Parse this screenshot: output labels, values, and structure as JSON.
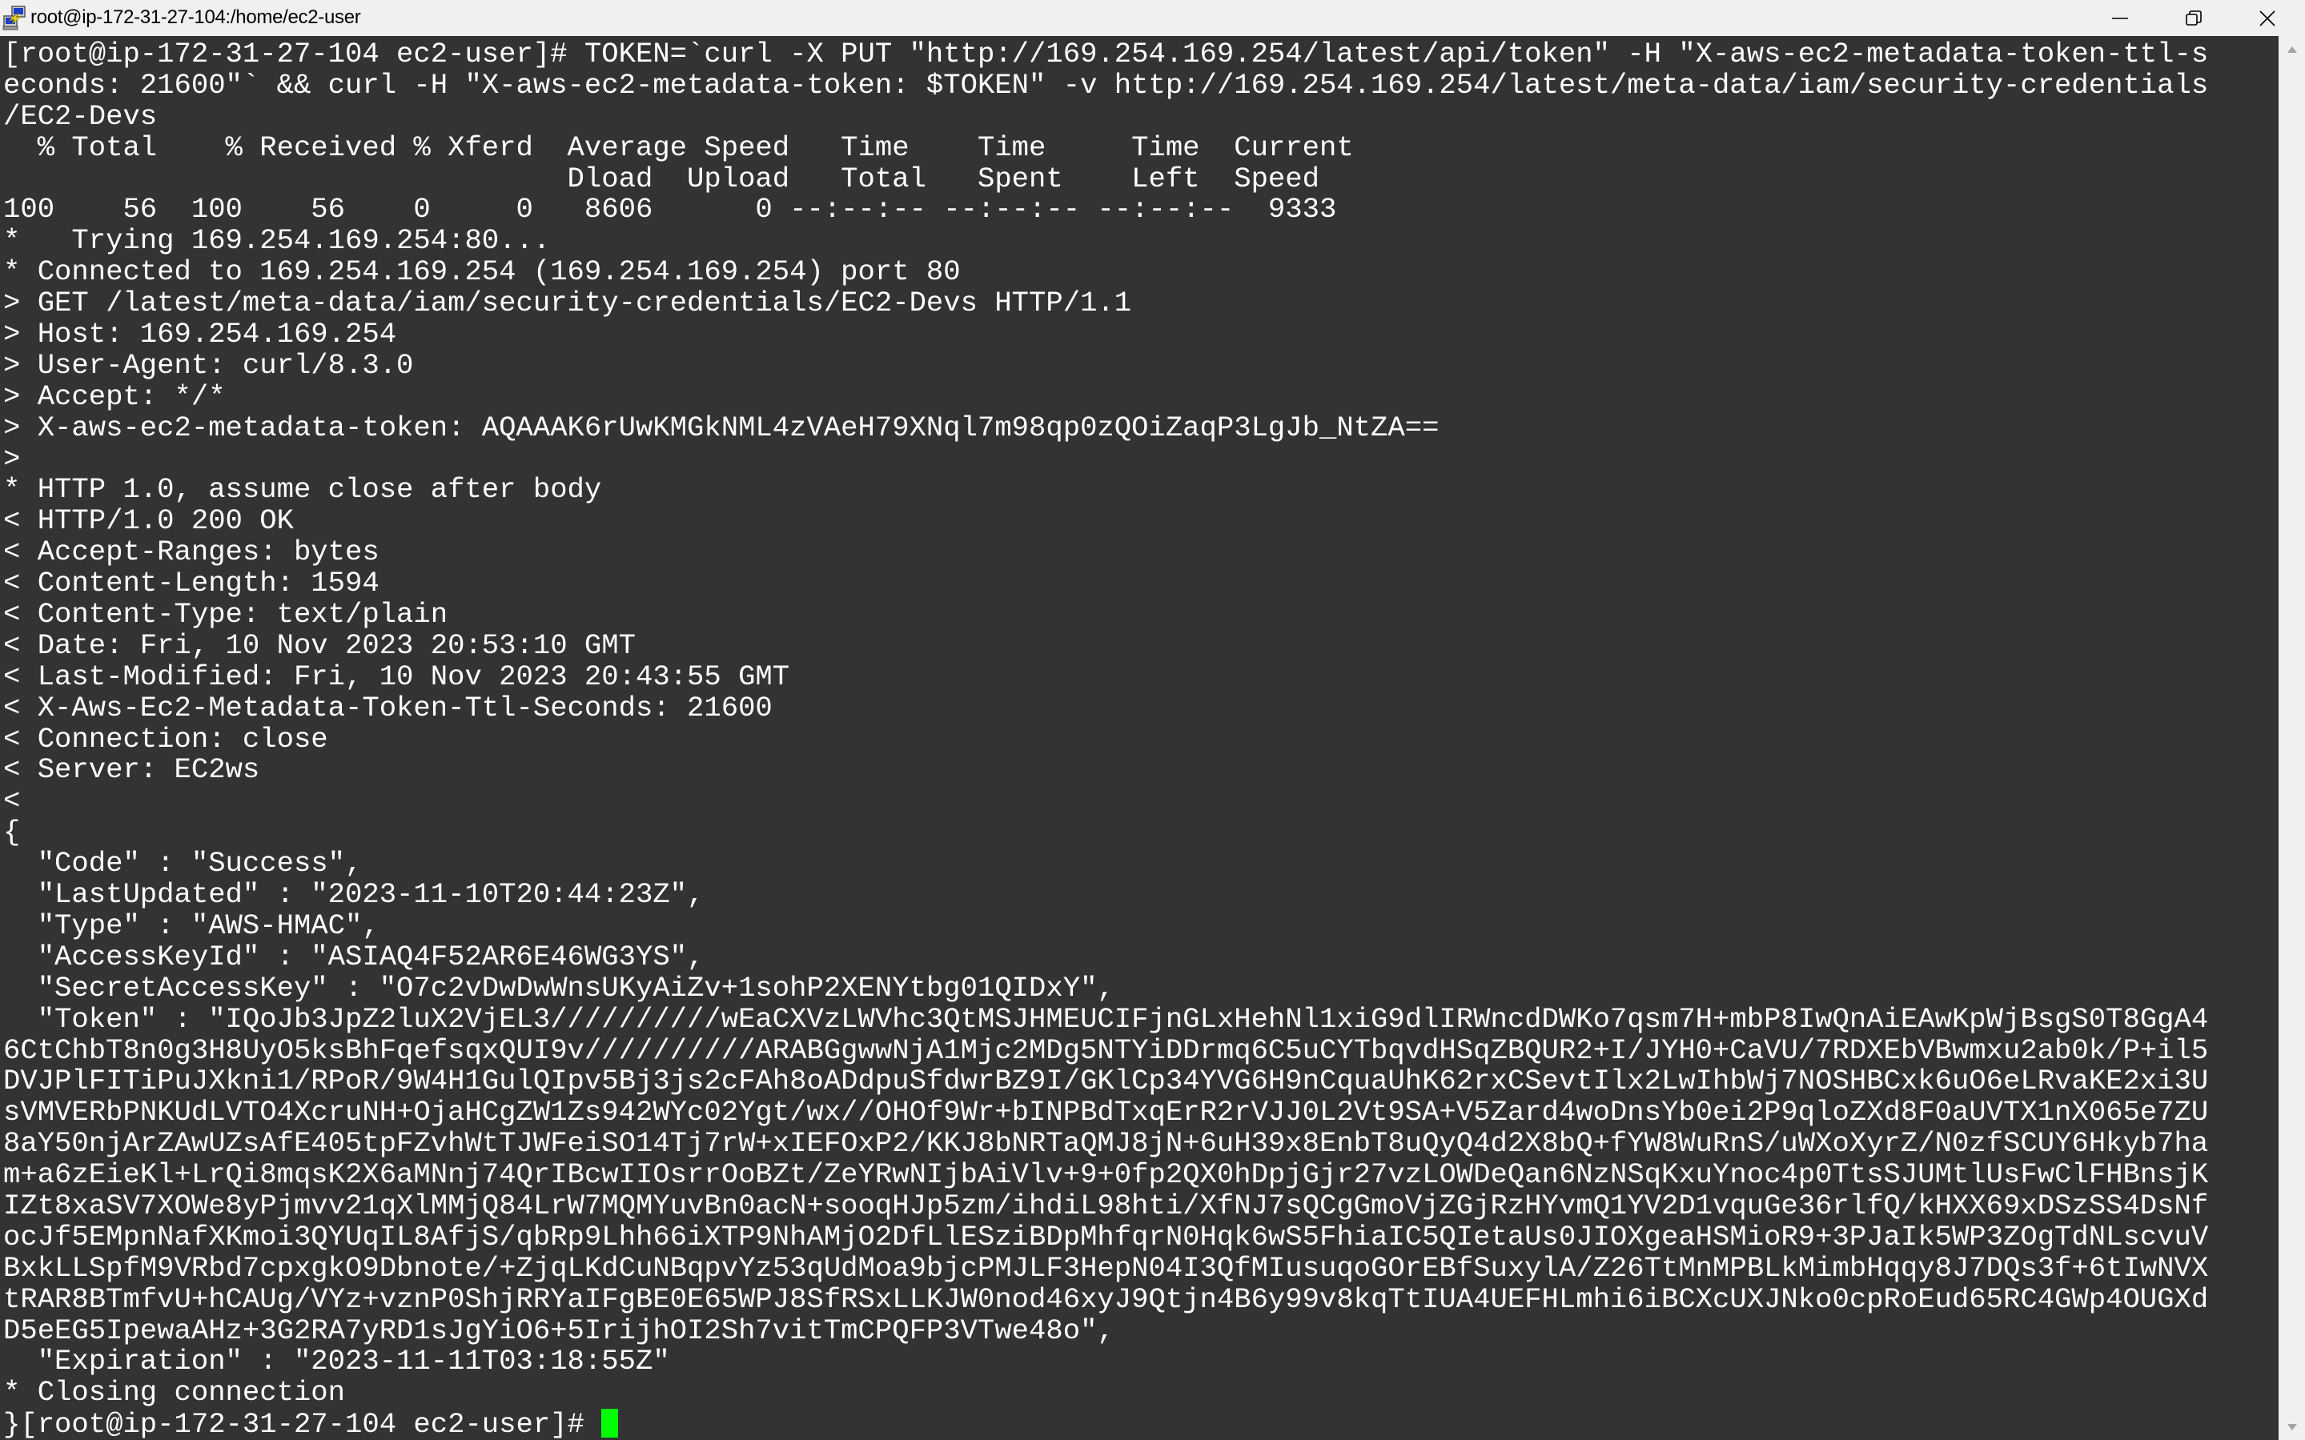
{
  "window": {
    "title": "root@ip-172-31-27-104:/home/ec2-user",
    "app_icon": "putty-icon",
    "controls": {
      "minimize": "minimize-icon",
      "maximize": "restore-icon",
      "close": "close-icon"
    }
  },
  "colors": {
    "terminal_background": "#333333",
    "terminal_foreground": "#ffffff",
    "cursor": "#00ff00",
    "titlebar_background": "#f0f0f0",
    "scrollbar_background": "#f0f0f0",
    "scrollbar_arrow": "#a3a3a3"
  },
  "terminal": {
    "lines": [
      "[root@ip-172-31-27-104 ec2-user]# TOKEN=`curl -X PUT \"http://169.254.169.254/latest/api/token\" -H \"X-aws-ec2-metadata-token-ttl-s",
      "econds: 21600\"` && curl -H \"X-aws-ec2-metadata-token: $TOKEN\" -v http://169.254.169.254/latest/meta-data/iam/security-credentials",
      "/EC2-Devs",
      "  % Total    % Received % Xferd  Average Speed   Time    Time     Time  Current",
      "                                 Dload  Upload   Total   Spent    Left  Speed",
      "100    56  100    56    0     0   8606      0 --:--:-- --:--:-- --:--:--  9333",
      "*   Trying 169.254.169.254:80...",
      "* Connected to 169.254.169.254 (169.254.169.254) port 80",
      "> GET /latest/meta-data/iam/security-credentials/EC2-Devs HTTP/1.1",
      "> Host: 169.254.169.254",
      "> User-Agent: curl/8.3.0",
      "> Accept: */*",
      "> X-aws-ec2-metadata-token: AQAAAK6rUwKMGkNML4zVAeH79XNql7m98qp0zQOiZaqP3LgJb_NtZA==",
      ">",
      "* HTTP 1.0, assume close after body",
      "< HTTP/1.0 200 OK",
      "< Accept-Ranges: bytes",
      "< Content-Length: 1594",
      "< Content-Type: text/plain",
      "< Date: Fri, 10 Nov 2023 20:53:10 GMT",
      "< Last-Modified: Fri, 10 Nov 2023 20:43:55 GMT",
      "< X-Aws-Ec2-Metadata-Token-Ttl-Seconds: 21600",
      "< Connection: close",
      "< Server: EC2ws",
      "<",
      "{",
      "  \"Code\" : \"Success\",",
      "  \"LastUpdated\" : \"2023-11-10T20:44:23Z\",",
      "  \"Type\" : \"AWS-HMAC\",",
      "  \"AccessKeyId\" : \"ASIAQ4F52AR6E46WG3YS\",",
      "  \"SecretAccessKey\" : \"O7c2vDwDwWnsUKyAiZv+1sohP2XENYtbg01QIDxY\",",
      "  \"Token\" : \"IQoJb3JpZ2luX2VjEL3//////////wEaCXVzLWVhc3QtMSJHMEUCIFjnGLxHehNl1xiG9dlIRWncdDWKo7qsm7H+mbP8IwQnAiEAwKpWjBsgS0T8GgA4",
      "6CtChbT8n0g3H8UyO5ksBhFqefsqxQUI9v//////////ARABGgwwNjA1Mjc2MDg5NTYiDDrmq6C5uCYTbqvdHSqZBQUR2+I/JYH0+CaVU/7RDXEbVBwmxu2ab0k/P+il5",
      "DVJPlFITiPuJXkni1/RPoR/9W4H1GulQIpv5Bj3js2cFAh8oADdpuSfdwrBZ9I/GKlCp34YVG6H9nCquaUhK62rxCSevtIlx2LwIhbWj7NOSHBCxk6uO6eLRvaKE2xi3U",
      "sVMVERbPNKUdLVTO4XcruNH+OjaHCgZW1Zs942WYc02Ygt/wx//OHOf9Wr+bINPBdTxqErR2rVJJ0L2Vt9SA+V5Zard4woDnsYb0ei2P9qloZXd8F0aUVTX1nX065e7ZU",
      "8aY50njArZAwUZsAfE405tpFZvhWtTJWFeiSO14Tj7rW+xIEFOxP2/KKJ8bNRTaQMJ8jN+6uH39x8EnbT8uQyQ4d2X8bQ+fYW8WuRnS/uWXoXyrZ/N0zfSCUY6Hkyb7ha",
      "m+a6zEieKl+LrQi8mqsK2X6aMNnj74QrIBcwIIOsrrOoBZt/ZeYRwNIjbAiVlv+9+0fp2QX0hDpjGjr27vzLOWDeQan6NzNSqKxuYnoc4p0TtsSJUMtlUsFwClFHBnsjK",
      "IZt8xaSV7XOWe8yPjmvv21qXlMMjQ84LrW7MQMYuvBn0acN+sooqHJp5zm/ihdiL98hti/XfNJ7sQCgGmoVjZGjRzHYvmQ1YV2D1vquGe36rlfQ/kHXX69xDSzSS4DsNf",
      "ocJf5EMpnNafXKmoi3QYUqIL8AfjS/qbRp9Lhh66iXTP9NhAMjO2DfLlESziBDpMhfqrN0Hqk6wS5FhiaIC5QIetaUs0JIOXgeaHSMioR9+3PJaIk5WP3ZOgTdNLscvuV",
      "BxkLLSpfM9VRbd7cpxgkO9Dbnote/+ZjqLKdCuNBqpvYz53qUdMoa9bjcPMJLF3HepN04I3QfMIusuqoGOrEBfSuxylA/Z26TtMnMPBLkMimbHqqy8J7DQs3f+6tIwNVX",
      "tRAR8BTmfvU+hCAUg/VYz+vznP0ShjRRYaIFgBE0E65WPJ8SfRSxLLKJW0nod46xyJ9Qtjn4B6y99v8kqTtIUA4UEFHLmhi6iBCXcUXJNko0cpRoEud65RC4GWp4OUGXd",
      "D5eEG5IpewaAHz+3G2RA7yRD1sJgYiO6+5IrijhOI2Sh7vitTmCPQFP3VTwe48o\",",
      "  \"Expiration\" : \"2023-11-11T03:18:55Z\"",
      "* Closing connection",
      "}[root@ip-172-31-27-104 ec2-user]# "
    ]
  }
}
